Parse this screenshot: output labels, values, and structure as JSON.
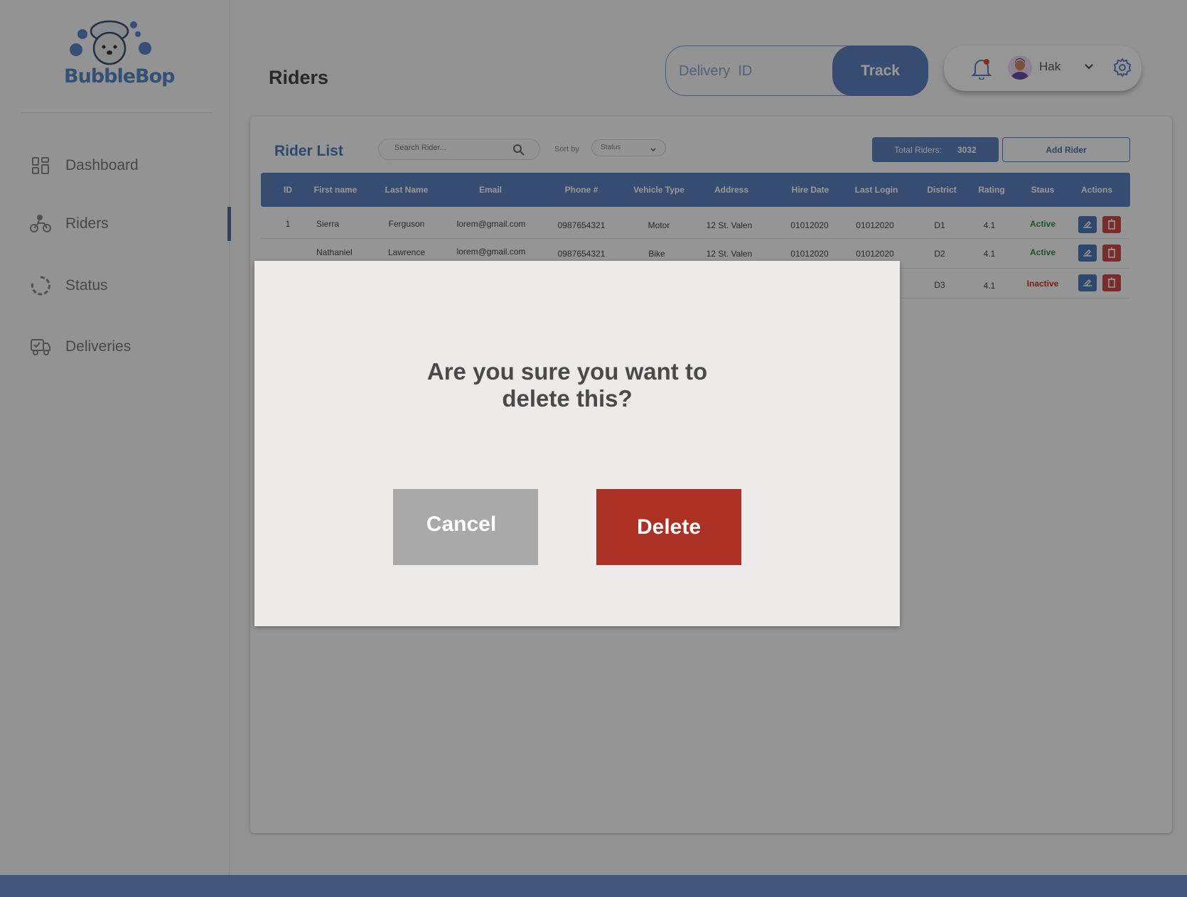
{
  "brand": {
    "name": "BubbleBop"
  },
  "sidebar": {
    "items": [
      {
        "label": "Dashboard",
        "icon": "grid-icon"
      },
      {
        "label": "Riders",
        "icon": "motorbike-icon",
        "active": true
      },
      {
        "label": "Status",
        "icon": "loading-circle-icon"
      },
      {
        "label": "Deliveries",
        "icon": "delivery-truck-icon"
      }
    ]
  },
  "header": {
    "title": "Riders",
    "track": {
      "placeholder": "Delivery  ID",
      "button_label": "Track"
    },
    "user": {
      "name": "Hak"
    }
  },
  "rider_list": {
    "title": "Rider List",
    "search_placeholder": "Search Rider...",
    "sort_label": "Sort by",
    "sort_value": "Status",
    "total_label": "Total Riders:",
    "total_value": "3032",
    "add_button": "Add Rider",
    "columns": [
      "ID",
      "First name",
      "Last Name",
      "Email",
      "Phone #",
      "Vehicle Type",
      "Address",
      "Hire Date",
      "Last Login",
      "District",
      "Rating",
      "Staus",
      "Actions"
    ],
    "rows": [
      {
        "id": "1",
        "first": "Sierra",
        "last": "Ferguson",
        "email": "lorem@gmail.com",
        "phone": "0987654321",
        "vehicle": "Motor",
        "address": "12 St. Valen",
        "hire": "01012020",
        "login": "01012020",
        "district": "D1",
        "rating": "4.1",
        "status": "Active"
      },
      {
        "id": "",
        "first": "Nathaniel",
        "last": "Lawrence",
        "email": "lorem@gmail.com",
        "phone": "0987654321",
        "vehicle": "Bike",
        "address": "12 St. Valen",
        "hire": "01012020",
        "login": "01012020",
        "district": "D2",
        "rating": "4.1",
        "status": "Active"
      },
      {
        "id": "",
        "first": "",
        "last": "",
        "email": "",
        "phone": "",
        "vehicle": "",
        "address": "",
        "hire": "",
        "login": "",
        "district": "D3",
        "rating": "4.1",
        "status": "Inactive"
      }
    ]
  },
  "modal": {
    "message_line1": "Are you sure you want to",
    "message_line2": "delete this?",
    "cancel_label": "Cancel",
    "delete_label": "Delete"
  },
  "colors": {
    "accent": "#5b7fbd",
    "danger": "#ad3024",
    "active": "#2e8a3e",
    "inactive": "#c0392b"
  }
}
